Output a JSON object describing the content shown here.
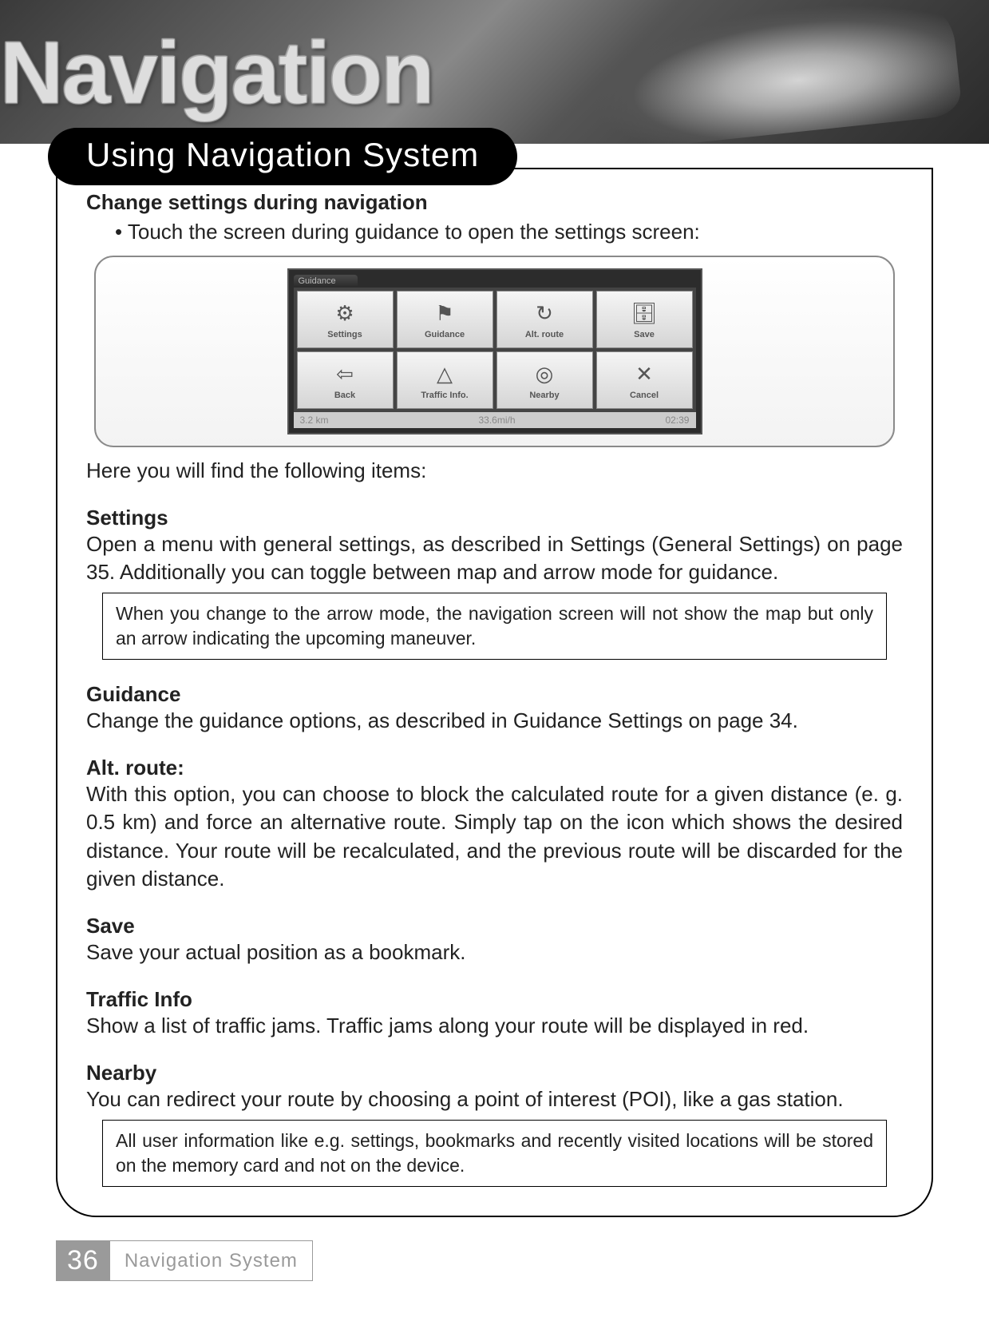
{
  "header": {
    "graphic_word": "Navigation",
    "pill_title": "Using Navigation System"
  },
  "section": {
    "heading": "Change settings during navigation",
    "bullet": "• Touch the screen during guidance to open the settings screen:"
  },
  "screenshot": {
    "tab": "Guidance",
    "cells": [
      {
        "icon": "⚙",
        "label": "Settings"
      },
      {
        "icon": "⚑",
        "label": "Guidance"
      },
      {
        "icon": "↻",
        "label": "Alt. route"
      },
      {
        "icon": "🗄",
        "label": "Save"
      },
      {
        "icon": "⇦",
        "label": "Back"
      },
      {
        "icon": "△",
        "label": "Traffic Info."
      },
      {
        "icon": "◎",
        "label": "Nearby"
      },
      {
        "icon": "✕",
        "label": "Cancel"
      }
    ],
    "status": {
      "left": "3.2 km",
      "center": "33.6mi/h",
      "right": "02:39"
    }
  },
  "intro": "Here you will find the following items:",
  "items": {
    "settings": {
      "head": "Settings",
      "body": "Open a menu with general settings, as described in Settings (General Settings) on page 35. Additionally you can toggle between map and arrow mode for guidance.",
      "note": "When you change to the arrow mode, the navigation screen will not show the map but only an arrow indicating the upcoming maneuver."
    },
    "guidance": {
      "head": "Guidance",
      "body": "Change the guidance options, as described in Guidance Settings on page 34."
    },
    "altroute": {
      "head": "Alt. route:",
      "body": "With this option, you can choose to block the calculated route for a given distance (e. g. 0.5 km) and force an alternative route. Simply tap on the icon which shows the desired distance. Your route will be recalculated, and the previous route will be discarded for the given distance."
    },
    "save": {
      "head": "Save",
      "body": "Save your actual position as a bookmark."
    },
    "traffic": {
      "head": "Traffic Info",
      "body": "Show a list of traffic jams. Traffic jams along your route will be displayed in red."
    },
    "nearby": {
      "head": "Nearby",
      "body": "You can redirect your route by choosing a point of interest (POI), like a gas station.",
      "note": "All user information like e.g. settings, bookmarks and recently visited locations will be stored on the memory card and not on the device."
    }
  },
  "footer": {
    "page": "36",
    "label": "Navigation System"
  }
}
